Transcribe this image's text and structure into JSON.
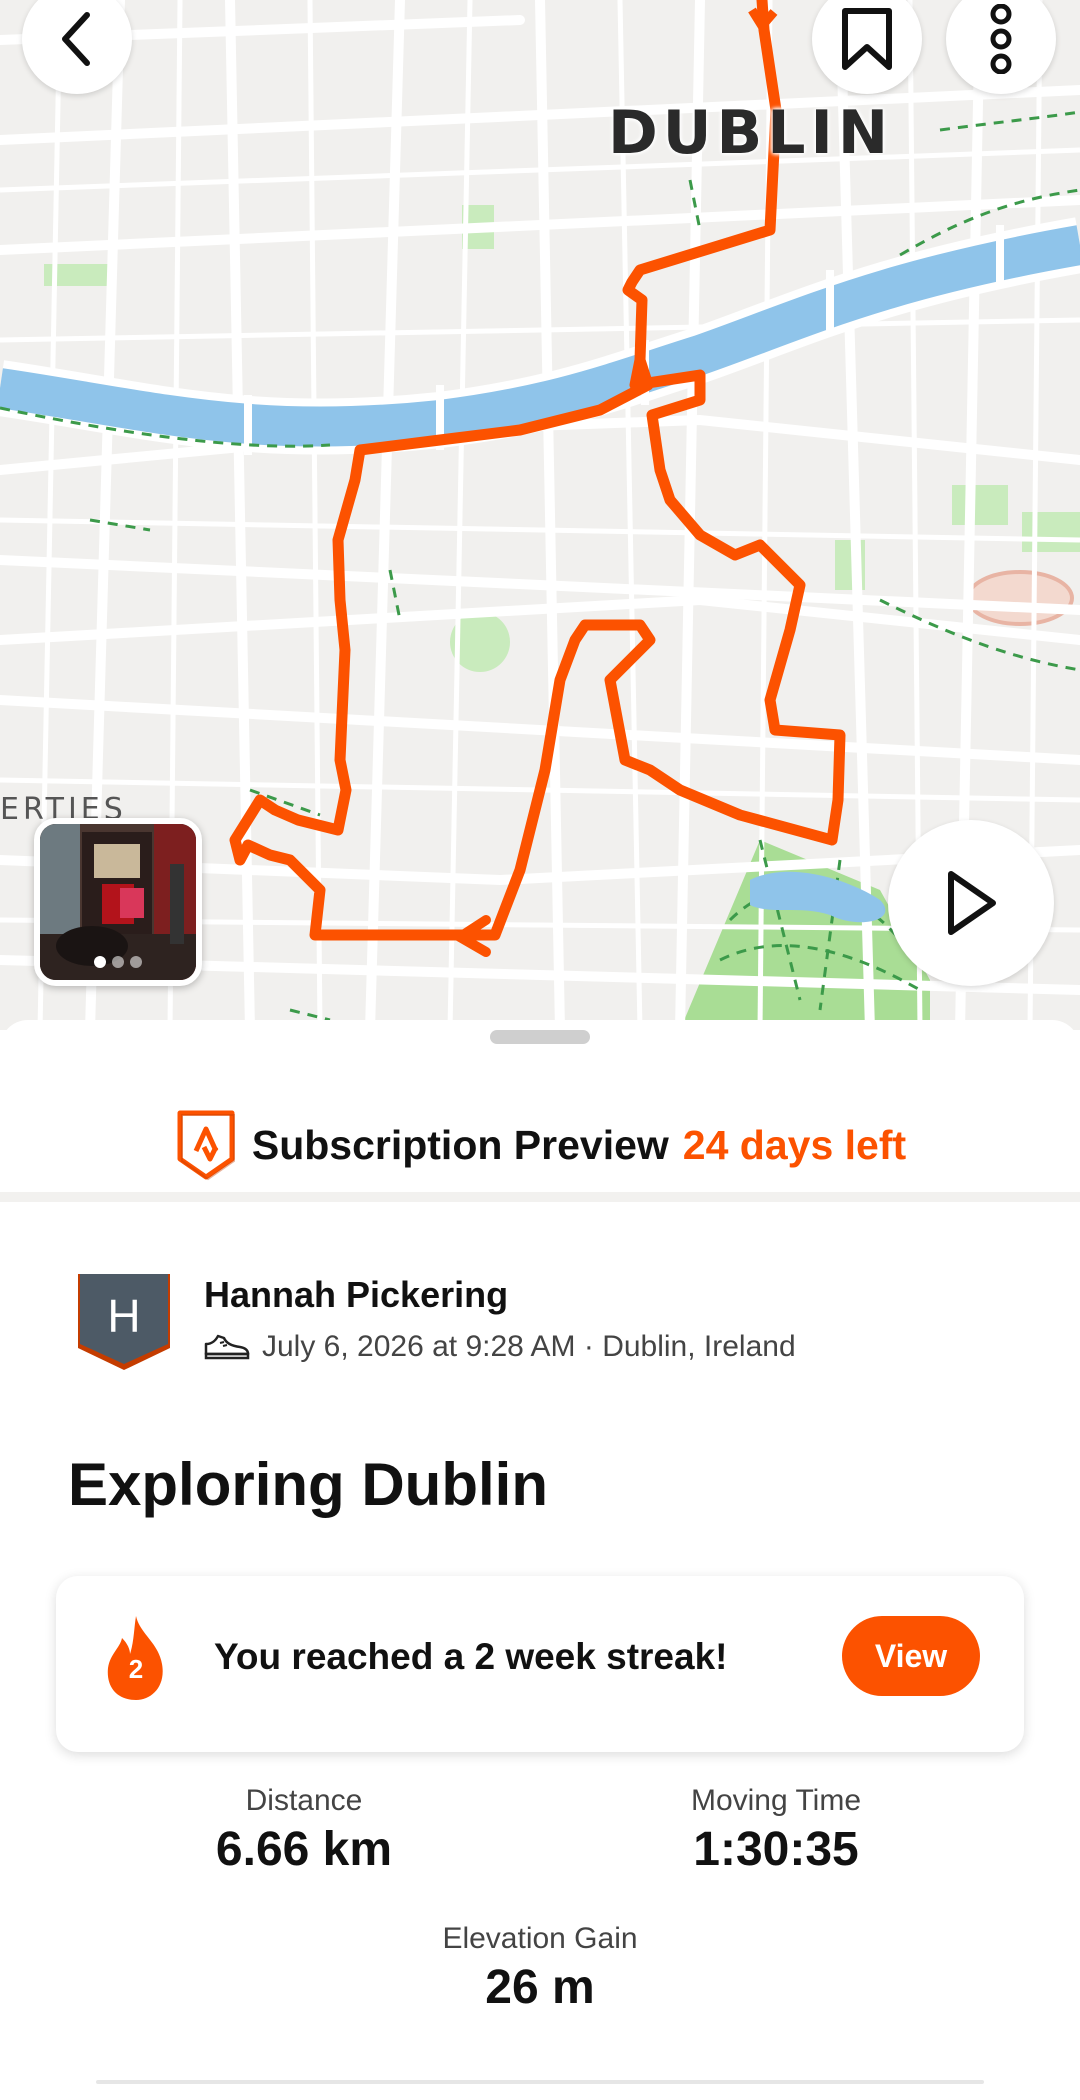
{
  "map": {
    "city_label": "DUBLIN",
    "area_label": "ERTIES",
    "colors": {
      "route": "#fc5200",
      "river": "#8fc4ea",
      "park": "#b8e3a8",
      "background": "#f1f0ee",
      "street": "#ffffff"
    },
    "icons": {
      "back": "chevron-left-icon",
      "bookmark": "bookmark-icon",
      "more": "more-vertical-icon",
      "play": "play-icon"
    },
    "photo": {
      "page_count": 3,
      "active_index": 0
    }
  },
  "subscription": {
    "title": "Subscription Preview",
    "remaining": "24 days left",
    "icon": "strava-shield-icon",
    "accent_color": "#fc5200"
  },
  "athlete": {
    "initial": "H",
    "name": "Hannah Pickering",
    "activity_icon": "shoe-icon",
    "date_location": "July 6, 2026 at 9:28 AM · Dublin, Ireland"
  },
  "activity": {
    "title": "Exploring Dublin"
  },
  "streak": {
    "count": "2",
    "message": "You reached a 2 week streak!",
    "button_label": "View"
  },
  "stats": {
    "distance": {
      "label": "Distance",
      "value": "6.66 km"
    },
    "moving_time": {
      "label": "Moving Time",
      "value": "1:30:35"
    },
    "elevation_gain": {
      "label": "Elevation Gain",
      "value": "26 m"
    }
  }
}
